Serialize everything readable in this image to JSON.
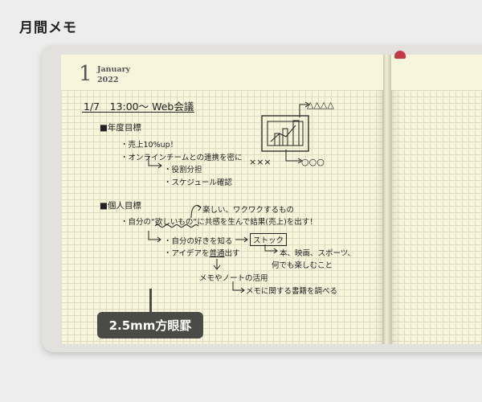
{
  "heading": "月間メモ",
  "calendar": {
    "month_number": "1",
    "month_name": "January",
    "year": "2022"
  },
  "notes": {
    "title": "1/7　13:00～ Web会議",
    "section1": {
      "label": "■年度目標",
      "items": [
        "・売上10%up！",
        "・オンラインチームとの連携を密に"
      ],
      "sub_items": [
        "・役割分担",
        "・スケジュール確認"
      ]
    },
    "sketch": {
      "triangles": "△△△△",
      "crosses": "×××",
      "circles": "○○○"
    },
    "section2": {
      "label": "■個人目標",
      "annotation": "楽しい、ワクワクするもの",
      "line_prefix": "・自分の",
      "line_quote": "“欲しいもの”",
      "line_suffix": "に共感を生んで結果(売上)を出す！",
      "sub1": "・自分の好きを知る",
      "box_word": "ストック",
      "sub2_prefix": "・アイデアを",
      "sub2_under": "普通",
      "sub2_suffix": "出す",
      "side1": "本、映画、スポーツ、",
      "side2": "何でも楽しむこと",
      "memo": "メモやノートの活用",
      "memo_sub": "メモに関する書籍を調べる"
    }
  },
  "callout": {
    "label": "2.5mm方眼罫"
  }
}
